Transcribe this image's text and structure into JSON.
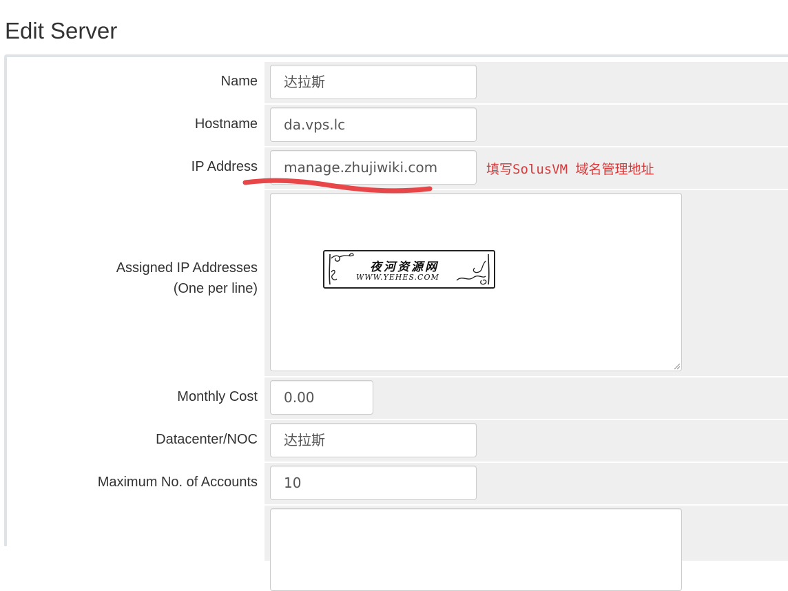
{
  "page": {
    "title": "Edit Server"
  },
  "form": {
    "name": {
      "label": "Name",
      "value": "达拉斯"
    },
    "hostname": {
      "label": "Hostname",
      "value": "da.vps.lc"
    },
    "ip_address": {
      "label": "IP Address",
      "value": "manage.zhujiwiki.com",
      "annotation": "填写SolusVM 域名管理地址",
      "annotation_color": "#d63a3a"
    },
    "assigned_ips": {
      "label_line1": "Assigned IP Addresses",
      "label_line2": "(One per line)",
      "value": ""
    },
    "monthly_cost": {
      "label": "Monthly Cost",
      "value": "0.00"
    },
    "datacenter": {
      "label": "Datacenter/NOC",
      "value": "达拉斯"
    },
    "max_accounts": {
      "label": "Maximum No. of Accounts",
      "value": "10"
    },
    "next_field": {
      "value": ""
    }
  },
  "watermark": {
    "title": "夜河资源网",
    "url": "WWW.YEHES.COM"
  },
  "colors": {
    "field_bg": "#efefef",
    "border": "#cccccc",
    "annotation_red": "#d63a3a"
  }
}
